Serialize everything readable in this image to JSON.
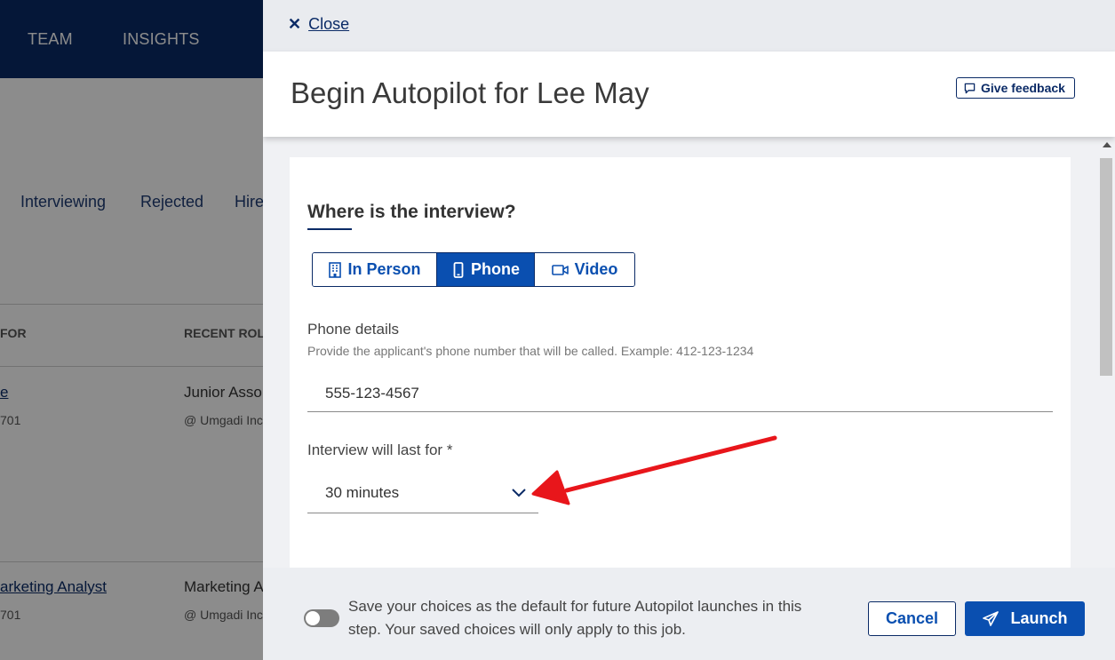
{
  "background": {
    "nav_items": [
      "TEAM",
      "INSIGHTS"
    ],
    "tabs": [
      "Interviewing",
      "Rejected",
      "Hire"
    ],
    "columns": [
      "FOR",
      "RECENT ROL"
    ],
    "rows": [
      {
        "name": "e",
        "id": "701",
        "role": "Junior Asso",
        "company": "@ Umgadi Inc"
      },
      {
        "name": "arketing Analyst",
        "id": "701",
        "role": "Marketing A",
        "company": "@ Umgadi Inc"
      }
    ]
  },
  "drawer": {
    "close_label": "Close",
    "title": "Begin Autopilot for Lee May",
    "feedback_label": "Give feedback",
    "section_title": "Where is the interview?",
    "location_options": [
      {
        "label": "In Person",
        "icon": "building-icon",
        "active": false
      },
      {
        "label": "Phone",
        "icon": "phone-icon",
        "active": true
      },
      {
        "label": "Video",
        "icon": "video-icon",
        "active": false
      }
    ],
    "phone_label": "Phone details",
    "phone_hint": "Provide the applicant's phone number that will be called. Example: 412-123-1234",
    "phone_value": "555-123-4567",
    "duration_label": "Interview will last for *",
    "duration_value": "30 minutes",
    "save_default_text": "Save your choices as the default for future Autopilot launches in this step. Your saved choices will only apply to this job.",
    "save_default_on": false,
    "cancel_label": "Cancel",
    "launch_label": "Launch"
  },
  "colors": {
    "brand_navy": "#0a2a66",
    "accent_blue": "#0a4fb0",
    "annotation_red": "#e8161b"
  }
}
